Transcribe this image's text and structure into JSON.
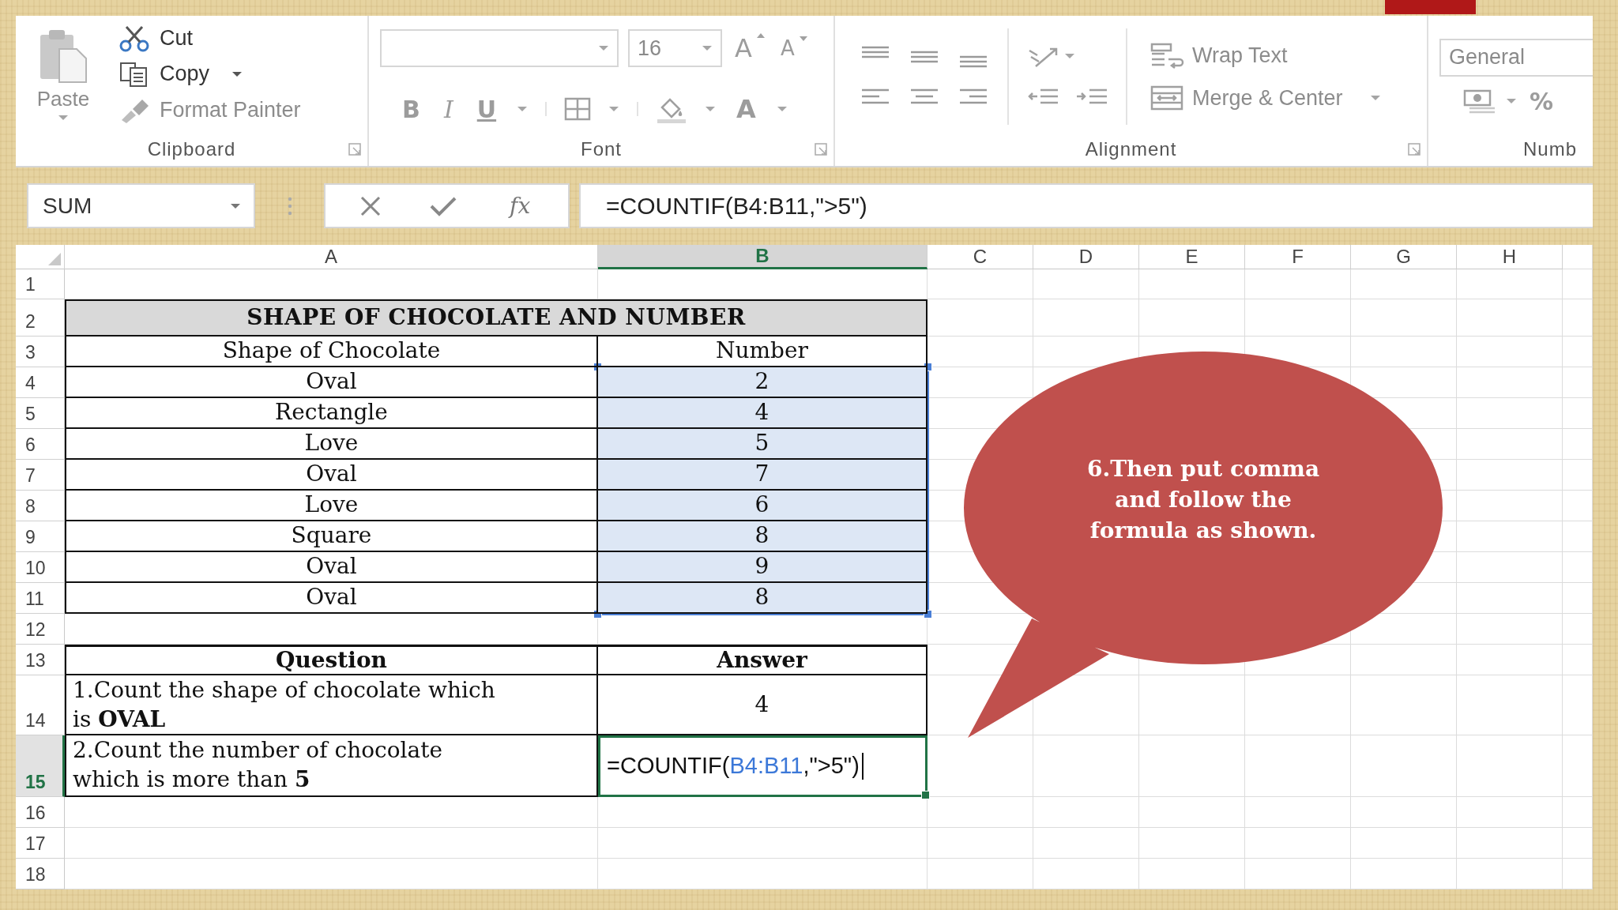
{
  "ribbon": {
    "clipboard": {
      "paste": {
        "label": "Paste",
        "disabled": true
      },
      "cut": {
        "label": "Cut",
        "disabled": false
      },
      "copy": {
        "label": "Copy",
        "disabled": false
      },
      "format_painter": {
        "label": "Format Painter",
        "disabled": true
      },
      "label": "Clipboard"
    },
    "font": {
      "size": "16",
      "grow": "A",
      "shrink": "A",
      "format_buttons": [
        "B",
        "I",
        "U"
      ],
      "font_color": "A",
      "label": "Font"
    },
    "alignment": {
      "wrap_text": {
        "label": "Wrap Text",
        "disabled": true
      },
      "merge_center": {
        "label": "Merge & Center",
        "disabled": true
      },
      "label": "Alignment"
    },
    "number": {
      "format": "General",
      "percent": "%",
      "label": "Numb"
    }
  },
  "formula_bar": {
    "name_box": "SUM",
    "fx": "fx",
    "formula": "=COUNTIF(B4:B11,\">5\")"
  },
  "columns": [
    {
      "label": "A",
      "selected": false
    },
    {
      "label": "B",
      "selected": true
    },
    {
      "label": "C",
      "selected": false
    },
    {
      "label": "D",
      "selected": false
    },
    {
      "label": "E",
      "selected": false
    },
    {
      "label": "F",
      "selected": false
    },
    {
      "label": "G",
      "selected": false
    },
    {
      "label": "H",
      "selected": false
    }
  ],
  "rows": [
    {
      "label": "1",
      "selected": false
    },
    {
      "label": "2",
      "selected": false
    },
    {
      "label": "3",
      "selected": false
    },
    {
      "label": "4",
      "selected": false
    },
    {
      "label": "5",
      "selected": false
    },
    {
      "label": "6",
      "selected": false
    },
    {
      "label": "7",
      "selected": false
    },
    {
      "label": "8",
      "selected": false
    },
    {
      "label": "9",
      "selected": false
    },
    {
      "label": "10",
      "selected": false
    },
    {
      "label": "11",
      "selected": false
    },
    {
      "label": "12",
      "selected": false
    },
    {
      "label": "13",
      "selected": false
    },
    {
      "label": "14",
      "selected": false
    },
    {
      "label": "15",
      "selected": true
    },
    {
      "label": "16",
      "selected": false
    },
    {
      "label": "17",
      "selected": false
    },
    {
      "label": "18",
      "selected": false
    }
  ],
  "table": {
    "title": "SHAPE OF CHOCOLATE AND NUMBER",
    "headers": [
      "Shape of Chocolate",
      "Number"
    ],
    "numbers_selected": true,
    "items": [
      {
        "shape": "Oval",
        "number": "2"
      },
      {
        "shape": "Rectangle",
        "number": "4"
      },
      {
        "shape": "Love",
        "number": "5"
      },
      {
        "shape": "Oval",
        "number": "7"
      },
      {
        "shape": "Love",
        "number": "6"
      },
      {
        "shape": "Square",
        "number": "8"
      },
      {
        "shape": "Oval",
        "number": "9"
      },
      {
        "shape": "Oval",
        "number": "8"
      }
    ]
  },
  "questions": {
    "headers": [
      "Question",
      "Answer"
    ],
    "items": [
      {
        "kind": "value",
        "question": "1.Count the shape of chocolate which is **OVAL**",
        "answer": "4"
      },
      {
        "kind": "editing",
        "question": "2.Count the number of chocolate which is more than **5**",
        "answer_parts": [
          {
            "kind": "function",
            "text": "=COUNTIF("
          },
          {
            "kind": "reference",
            "text": "B4:B11"
          },
          {
            "kind": "function",
            "text": ",\">5\")"
          }
        ]
      }
    ]
  },
  "callout": {
    "text": "6.Then put comma and follow the formula as shown."
  }
}
